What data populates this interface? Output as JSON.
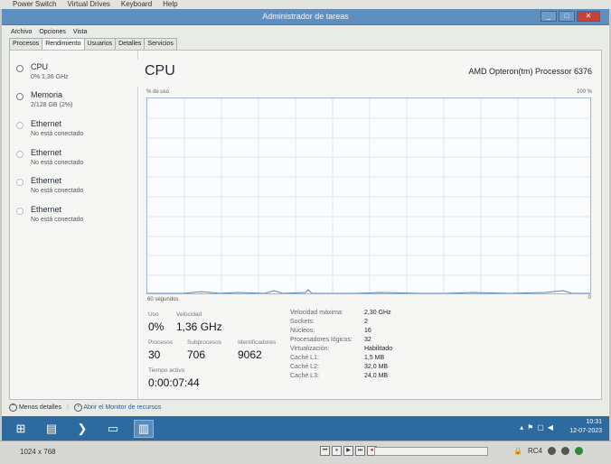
{
  "kvm_menu": [
    "Power Switch",
    "Virtual Drives",
    "Keyboard",
    "Help"
  ],
  "window": {
    "title": "Administrador de tareas",
    "buttons": [
      "_",
      "□",
      "✕"
    ]
  },
  "menu": [
    "Archivo",
    "Opciones",
    "Vista"
  ],
  "tabs": [
    "Procesos",
    "Rendimiento",
    "Usuarios",
    "Detalles",
    "Servicios"
  ],
  "sidebar": {
    "items": [
      {
        "title": "CPU",
        "sub": "0% 1,36 GHz"
      },
      {
        "title": "Memoria",
        "sub": "2/128 GB (2%)"
      },
      {
        "title": "Ethernet",
        "sub": "No está conectado"
      },
      {
        "title": "Ethernet",
        "sub": "No está conectado"
      },
      {
        "title": "Ethernet",
        "sub": "No está conectado"
      },
      {
        "title": "Ethernet",
        "sub": "No está conectado"
      }
    ]
  },
  "cpu": {
    "title": "CPU",
    "model": "AMD Opteron(tm) Processor 6376",
    "axis_label": "% de uso",
    "axis_max": "100 %",
    "axis_time": "60 segundos",
    "axis_min": "0",
    "stats": {
      "uso_label": "Uso",
      "uso": "0%",
      "velocidad_label": "Velocidad",
      "velocidad": "1,36 GHz",
      "procesos_label": "Procesos",
      "procesos": "30",
      "subprocesos_label": "Subprocesos",
      "subprocesos": "706",
      "identificadores_label": "Identificadores",
      "identificadores": "9062",
      "tiempo_label": "Tiempo activo",
      "tiempo": "0:00:07:44"
    },
    "details": [
      {
        "label": "Velocidad máxima:",
        "value": "2,30 GHz"
      },
      {
        "label": "Sockets:",
        "value": "2"
      },
      {
        "label": "Núcleos:",
        "value": "16"
      },
      {
        "label": "Procesadores lógicos:",
        "value": "32"
      },
      {
        "label": "Virtualización:",
        "value": "Habilitado"
      },
      {
        "label": "Caché L1:",
        "value": "1,5 MB"
      },
      {
        "label": "Caché L2:",
        "value": "32,0 MB"
      },
      {
        "label": "Caché L3:",
        "value": "24,0 MB"
      }
    ]
  },
  "footer": {
    "less_details": "Menos detalles",
    "resource_monitor": "Abrir el Monitor de recursos"
  },
  "taskbar": {
    "time": "10:31",
    "date": "12-07-2023"
  },
  "kvm_bottom": {
    "resolution": "1024 x 768",
    "controls": [
      "⏮",
      "⏸",
      "▶",
      "⏭",
      "●"
    ],
    "rc": "RC4"
  },
  "colors": {
    "titlebar": "#5f8fbf",
    "taskbar": "#2d6aa0",
    "graph_border": "#9bb7d4"
  }
}
